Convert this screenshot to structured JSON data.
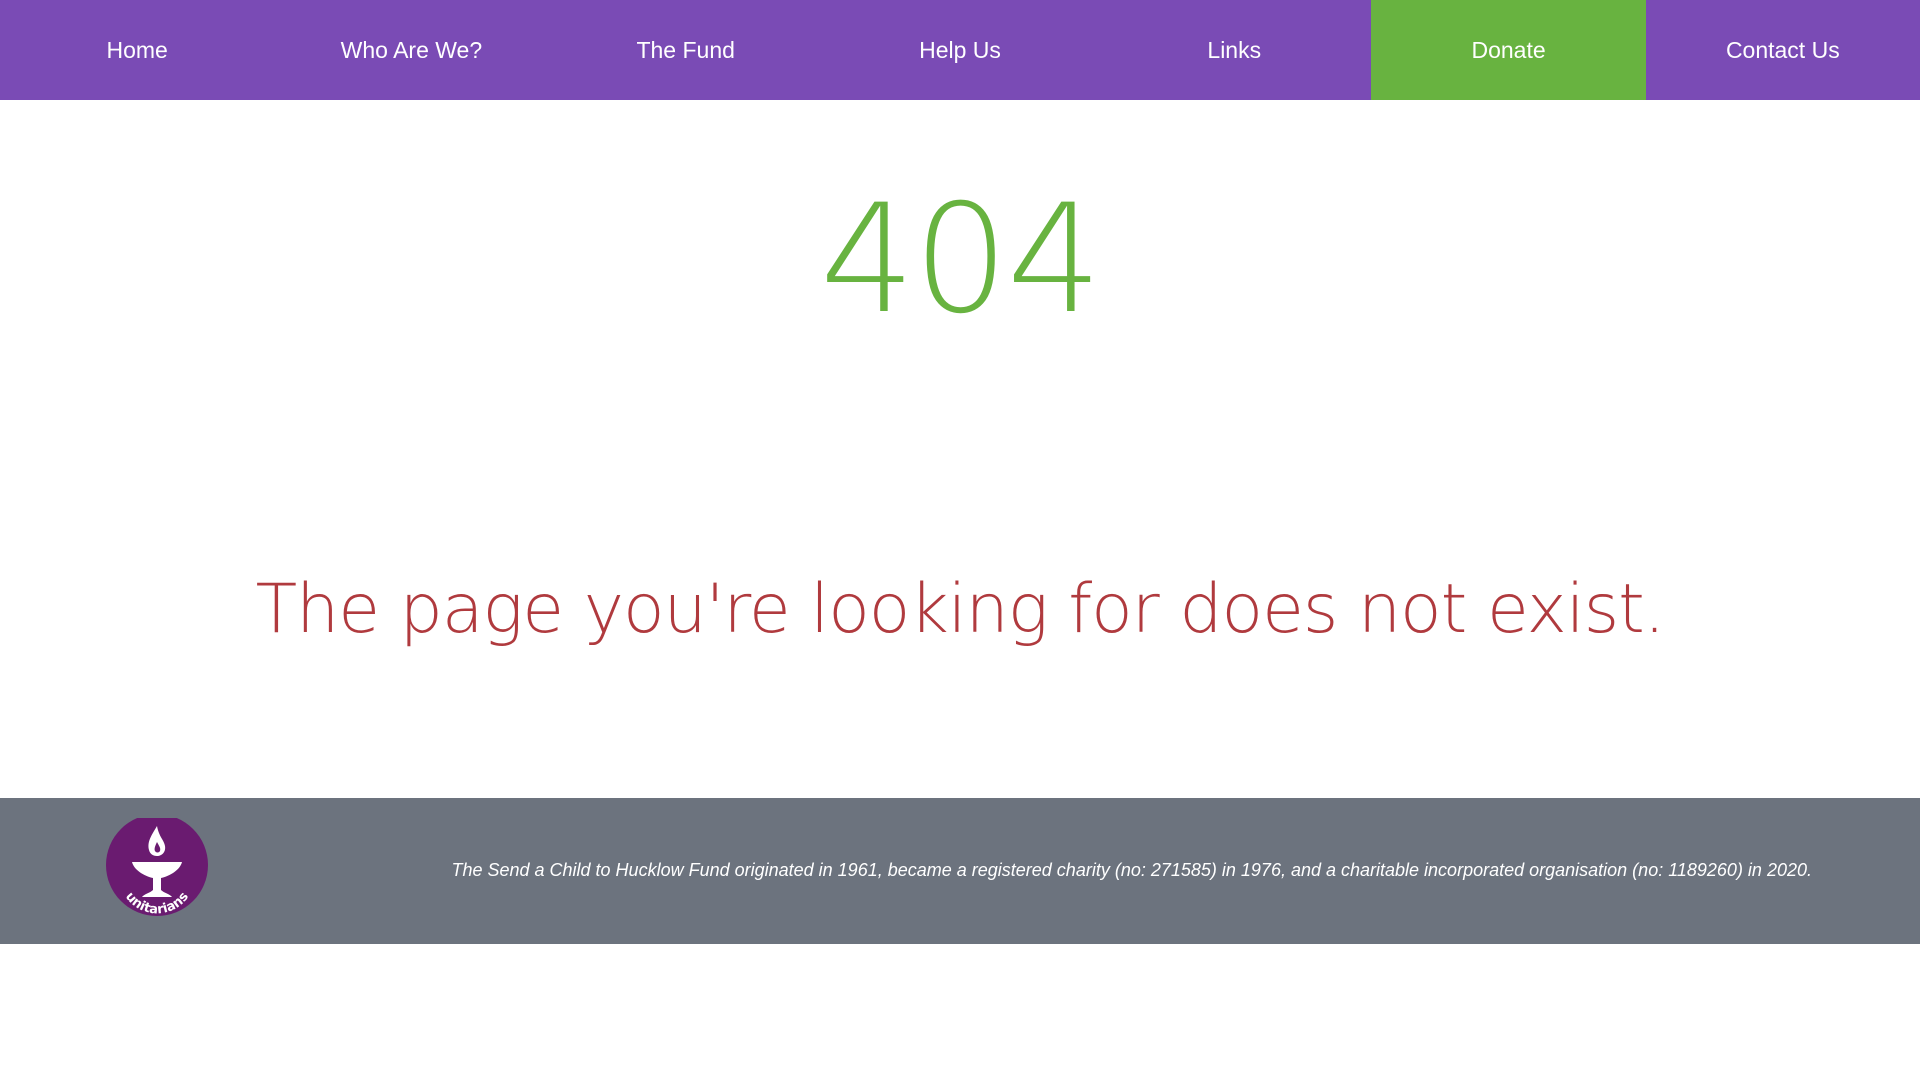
{
  "nav": {
    "items": [
      {
        "label": "Home"
      },
      {
        "label": "Who Are We?"
      },
      {
        "label": "The Fund"
      },
      {
        "label": "Help Us"
      },
      {
        "label": "Links"
      },
      {
        "label": "Donate",
        "active": true
      },
      {
        "label": "Contact Us"
      }
    ]
  },
  "error": {
    "code": "404",
    "message": "The page you're looking for does not exist."
  },
  "footer": {
    "logo_text": "unitarians",
    "logo_icon": "chalice-flame-icon",
    "text": "The Send a Child to Hucklow Fund originated in 1961, became a registered charity (no: 271585) in 1976, and a charitable incorporated organisation (no: 1189260) in 2020."
  },
  "colors": {
    "nav_bg": "#7a4bb5",
    "nav_active_bg": "#68b340",
    "code_color": "#68b340",
    "message_color": "#b03a3e",
    "footer_bg": "#6c737e",
    "logo_bg": "#6a1b70"
  }
}
